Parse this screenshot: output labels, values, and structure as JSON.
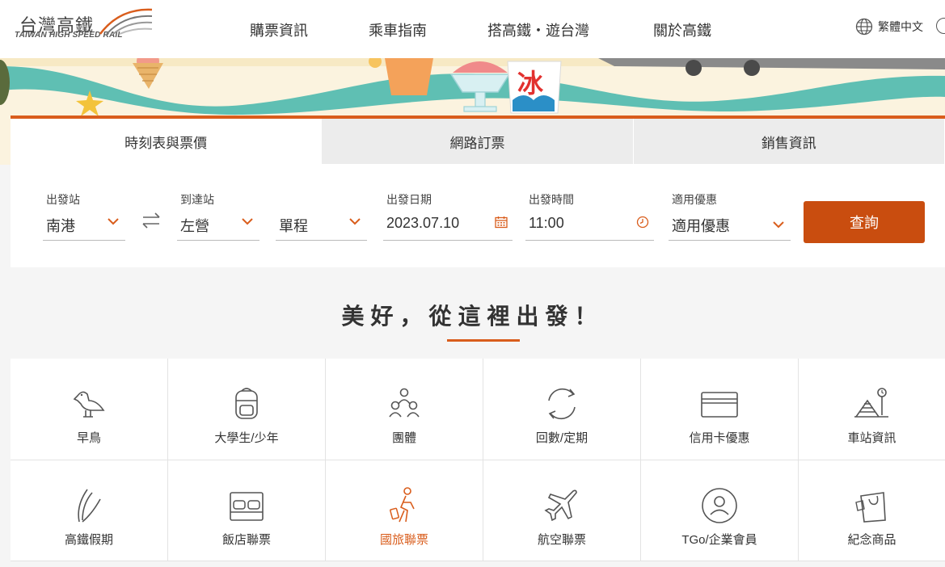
{
  "logo": {
    "zh": "台灣高鐵",
    "en": "TAIWAN HIGH SPEED RAIL"
  },
  "nav": [
    "購票資訊",
    "乘車指南",
    "搭高鐵・遊台灣",
    "關於高鐵"
  ],
  "language": "繁體中文",
  "banner": {
    "ice_sign": "冰"
  },
  "tabs": [
    "時刻表與票價",
    "網路訂票",
    "銷售資訊"
  ],
  "booking": {
    "origin": {
      "label": "出發站",
      "value": "南港"
    },
    "destination": {
      "label": "到達站",
      "value": "左營"
    },
    "trip_type": {
      "value": "單程"
    },
    "date": {
      "label": "出發日期",
      "value": "2023.07.10"
    },
    "time": {
      "label": "出發時間",
      "value": "11:00"
    },
    "discount": {
      "label": "適用優惠",
      "value": "適用優惠"
    },
    "search_label": "查詢"
  },
  "section_title": "美好，從這裡出發！",
  "services": [
    {
      "label": "早鳥",
      "icon": "bird-icon"
    },
    {
      "label": "大學生/少年",
      "icon": "backpack-icon"
    },
    {
      "label": "團體",
      "icon": "group-icon"
    },
    {
      "label": "回數/定期",
      "icon": "cycle-icon"
    },
    {
      "label": "信用卡優惠",
      "icon": "credit-card-icon"
    },
    {
      "label": "車站資訊",
      "icon": "station-icon"
    },
    {
      "label": "高鐵假期",
      "icon": "leaf-icon"
    },
    {
      "label": "飯店聯票",
      "icon": "bed-icon"
    },
    {
      "label": "國旅聯票",
      "icon": "traveler-icon",
      "highlight": true
    },
    {
      "label": "航空聯票",
      "icon": "airplane-icon"
    },
    {
      "label": "TGo/企業會員",
      "icon": "member-icon"
    },
    {
      "label": "紀念商品",
      "icon": "shopping-bag-icon"
    }
  ],
  "colors": {
    "accent": "#d95d1c",
    "button": "#c94d0f",
    "teal": "#5fbfb3"
  }
}
